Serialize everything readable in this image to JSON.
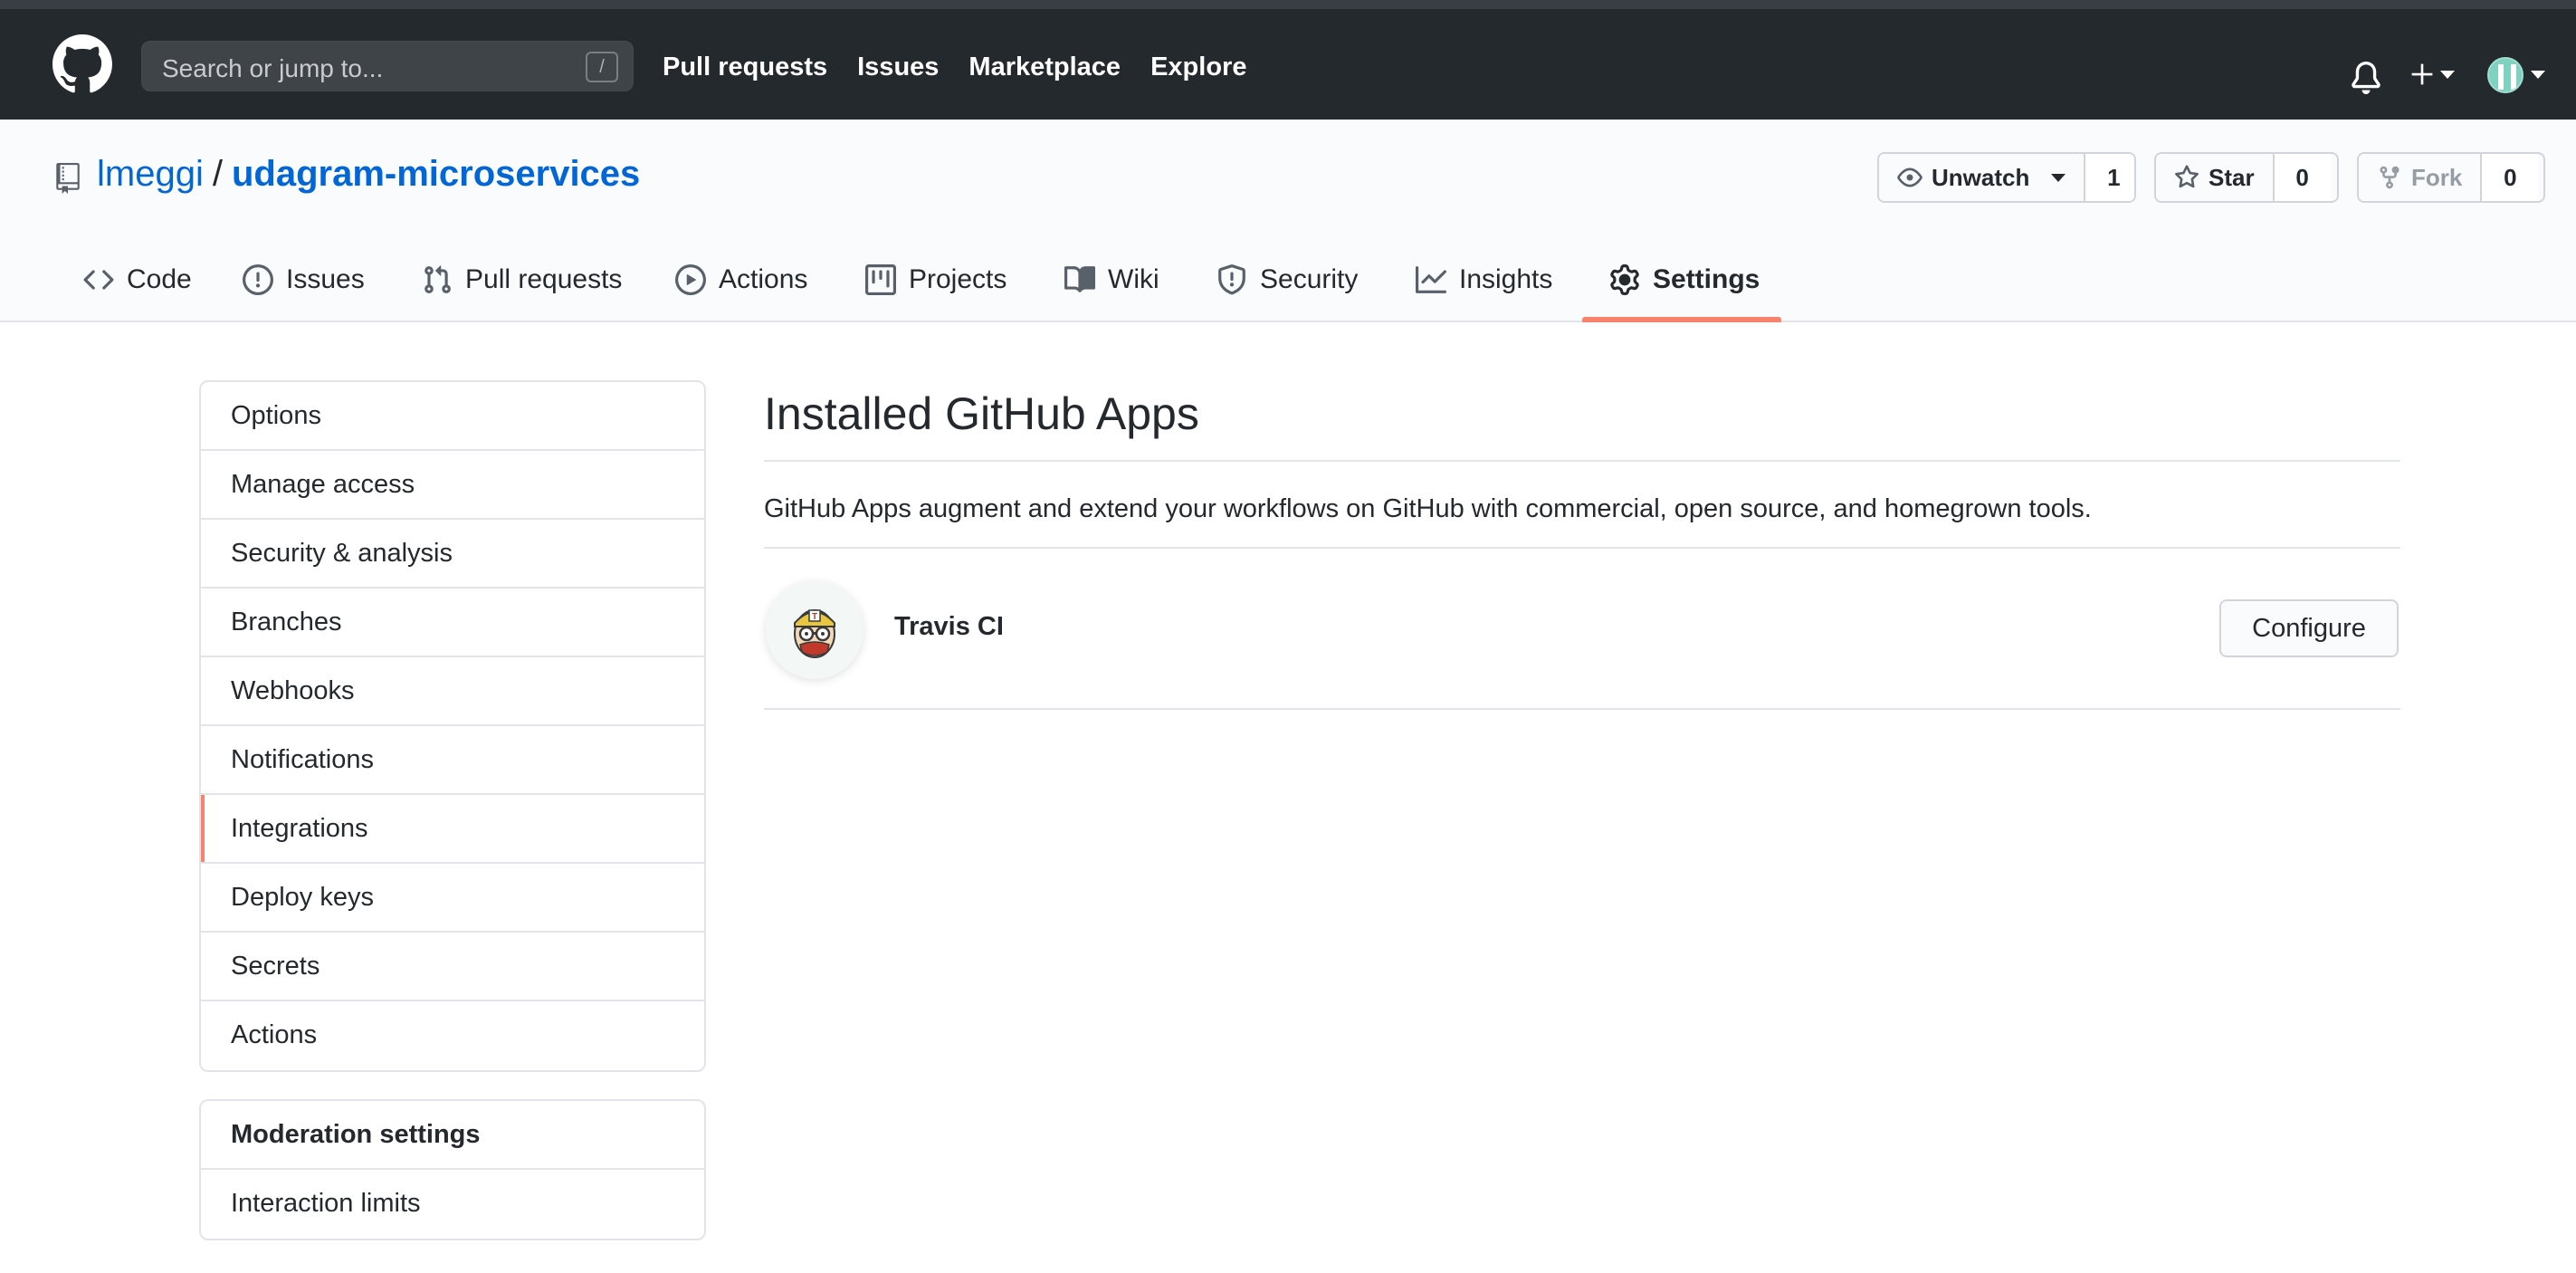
{
  "header": {
    "search_placeholder": "Search or jump to...",
    "search_shortcut": "/",
    "nav": [
      "Pull requests",
      "Issues",
      "Marketplace",
      "Explore"
    ]
  },
  "repo": {
    "owner": "lmeggi",
    "separator": "/",
    "name": "udagram-microservices",
    "watch": {
      "label": "Unwatch",
      "count": "1"
    },
    "star": {
      "label": "Star",
      "count": "0"
    },
    "fork": {
      "label": "Fork",
      "count": "0"
    }
  },
  "tabs": [
    {
      "label": "Code",
      "icon": "code-icon"
    },
    {
      "label": "Issues",
      "icon": "issue-icon"
    },
    {
      "label": "Pull requests",
      "icon": "pull-request-icon"
    },
    {
      "label": "Actions",
      "icon": "play-icon"
    },
    {
      "label": "Projects",
      "icon": "project-icon"
    },
    {
      "label": "Wiki",
      "icon": "book-icon"
    },
    {
      "label": "Security",
      "icon": "shield-icon"
    },
    {
      "label": "Insights",
      "icon": "graph-icon"
    },
    {
      "label": "Settings",
      "icon": "gear-icon",
      "selected": true
    }
  ],
  "sidebar": {
    "items": [
      "Options",
      "Manage access",
      "Security & analysis",
      "Branches",
      "Webhooks",
      "Notifications",
      "Integrations",
      "Deploy keys",
      "Secrets",
      "Actions"
    ],
    "selected": "Integrations",
    "moderation_heading": "Moderation settings",
    "moderation_items": [
      "Interaction limits"
    ]
  },
  "main": {
    "title": "Installed GitHub Apps",
    "description": "GitHub Apps augment and extend your workflows on GitHub with commercial, open source, and homegrown tools.",
    "apps": [
      {
        "name": "Travis CI",
        "action": "Configure"
      }
    ]
  },
  "colors": {
    "header_bg": "#24292e",
    "link": "#0366d6",
    "accent": "#f9826c"
  }
}
